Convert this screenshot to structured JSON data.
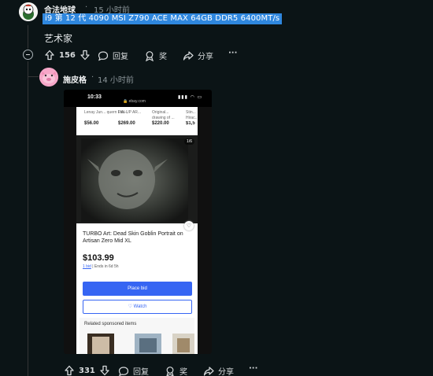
{
  "comment1": {
    "username": "合法地球",
    "separator": "·",
    "time": "15 小时前",
    "flair": "i9 第 12 代 4090 MSI Z790 ACE MAX 64GB DDR5 6400MT/s",
    "text": "艺术家",
    "votes": "156",
    "reply_label": "回复",
    "award_label": "奖",
    "share_label": "分享",
    "more_label": "···"
  },
  "comment2": {
    "username": "施皮格",
    "separator": "·",
    "time": "14 小时前",
    "votes": "331",
    "reply_label": "回复",
    "award_label": "奖",
    "share_label": "分享",
    "more_label": "···",
    "image": {
      "status_time": "10:33",
      "url": "🔒 ebay.com",
      "signal": "▮▮▮ ◠ ▭",
      "strip_items": [
        {
          "name": "Lenay Jun... quern Lau...",
          "price": "$56.00"
        },
        {
          "name": "PIN-UP AR...",
          "price": "$269.00"
        },
        {
          "name": "Original... drawing of ...",
          "price": "$220.00"
        },
        {
          "name": "Stin... Hirac...",
          "price": "$1,5"
        }
      ],
      "photo_counter": "1/6",
      "item_title": "TURBO Art: Dead Skin Goblin Portrait on Artisan Zero Mid XL",
      "price": "$103.99",
      "bids_link": "1 bid",
      "bids_rest": "| Ends in 6d 5h",
      "place_bid_label": "Place bid",
      "watch_label": "♡ Watch",
      "related_label": "Related sponsored items"
    }
  },
  "colors": {
    "background": "#0b1416",
    "flair_bg": "#2f87de",
    "ebay_blue": "#3665f3"
  }
}
